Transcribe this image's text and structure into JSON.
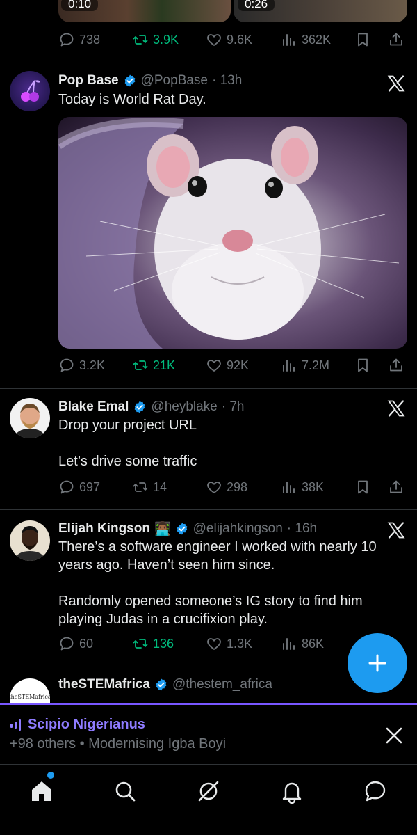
{
  "top_post": {
    "videos": [
      {
        "duration": "0:10"
      },
      {
        "duration": "0:26"
      }
    ],
    "stats": {
      "replies": "738",
      "reposts": "3.9K",
      "likes": "9.6K",
      "views": "362K"
    }
  },
  "tweets": [
    {
      "name": "Pop Base",
      "handle": "@PopBase",
      "time": "· 13h",
      "text": "Today is World Rat Day.",
      "stats": {
        "replies": "3.2K",
        "reposts": "21K",
        "likes": "92K",
        "views": "7.2M"
      }
    },
    {
      "name": "Blake Emal",
      "handle": "@heyblake",
      "time": "· 7h",
      "text": "Drop your project URL\n\nLet’s drive some traffic",
      "stats": {
        "replies": "697",
        "reposts": "14",
        "likes": "298",
        "views": "38K"
      }
    },
    {
      "name": "Elijah Kingson",
      "emoji": "👨🏾‍💻",
      "handle": "@elijahkingson",
      "time": "· 16h",
      "text": "There’s a software engineer I worked with nearly 10 years ago. Haven’t seen him since.\n\nRandomly opened someone’s IG story to find him playing Judas in a crucifixion play.",
      "stats": {
        "replies": "60",
        "reposts": "136",
        "likes": "1.3K",
        "views": "86K"
      }
    },
    {
      "name": "theSTEMafrica",
      "handle": "@thestem_africa",
      "avatar_text": "theSTEMafrica"
    }
  ],
  "space": {
    "title": "Scipio Nigerianus",
    "subtitle": "+98 others • Modernising Igba Boyi"
  },
  "icons": {
    "reply": "reply-icon",
    "repost": "repost-icon",
    "like": "heart-icon",
    "views": "views-icon",
    "bookmark": "bookmark-icon",
    "share": "share-icon"
  },
  "colors": {
    "accent": "#1d9bf0",
    "repost_green": "#00ba7c",
    "space_purple": "#7856ff",
    "muted": "#71767b"
  }
}
